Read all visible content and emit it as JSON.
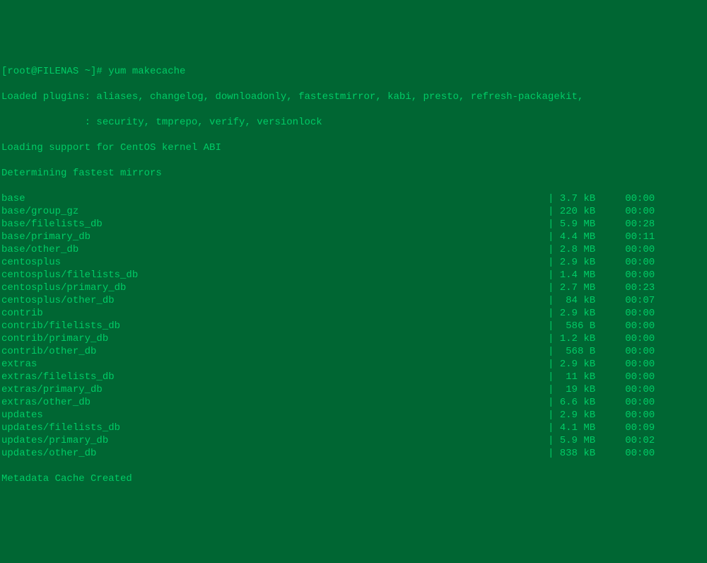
{
  "prompt": "[root@FILENAS ~]# ",
  "command": "yum makecache",
  "plugins_line1": "Loaded plugins: aliases, changelog, downloadonly, fastestmirror, kabi, presto, refresh-packagekit,",
  "plugins_line2": "              : security, tmprepo, verify, versionlock",
  "abi_line": "Loading support for CentOS kernel ABI",
  "mirrors_line": "Determining fastest mirrors",
  "rows": [
    {
      "name": "base",
      "size": "3.7 kB",
      "time": "00:00"
    },
    {
      "name": "base/group_gz",
      "size": "220 kB",
      "time": "00:00"
    },
    {
      "name": "base/filelists_db",
      "size": "5.9 MB",
      "time": "00:28"
    },
    {
      "name": "base/primary_db",
      "size": "4.4 MB",
      "time": "00:11"
    },
    {
      "name": "base/other_db",
      "size": "2.8 MB",
      "time": "00:00"
    },
    {
      "name": "centosplus",
      "size": "2.9 kB",
      "time": "00:00"
    },
    {
      "name": "centosplus/filelists_db",
      "size": "1.4 MB",
      "time": "00:00"
    },
    {
      "name": "centosplus/primary_db",
      "size": "2.7 MB",
      "time": "00:23"
    },
    {
      "name": "centosplus/other_db",
      "size": " 84 kB",
      "time": "00:07"
    },
    {
      "name": "contrib",
      "size": "2.9 kB",
      "time": "00:00"
    },
    {
      "name": "contrib/filelists_db",
      "size": " 586 B",
      "time": "00:00"
    },
    {
      "name": "contrib/primary_db",
      "size": "1.2 kB",
      "time": "00:00"
    },
    {
      "name": "contrib/other_db",
      "size": " 568 B",
      "time": "00:00"
    },
    {
      "name": "extras",
      "size": "2.9 kB",
      "time": "00:00"
    },
    {
      "name": "extras/filelists_db",
      "size": " 11 kB",
      "time": "00:00"
    },
    {
      "name": "extras/primary_db",
      "size": " 19 kB",
      "time": "00:00"
    },
    {
      "name": "extras/other_db",
      "size": "6.6 kB",
      "time": "00:00"
    },
    {
      "name": "updates",
      "size": "2.9 kB",
      "time": "00:00"
    },
    {
      "name": "updates/filelists_db",
      "size": "4.1 MB",
      "time": "00:09"
    },
    {
      "name": "updates/primary_db",
      "size": "5.9 MB",
      "time": "00:02"
    },
    {
      "name": "updates/other_db",
      "size": "838 kB",
      "time": "00:00"
    }
  ],
  "footer": "Metadata Cache Created"
}
